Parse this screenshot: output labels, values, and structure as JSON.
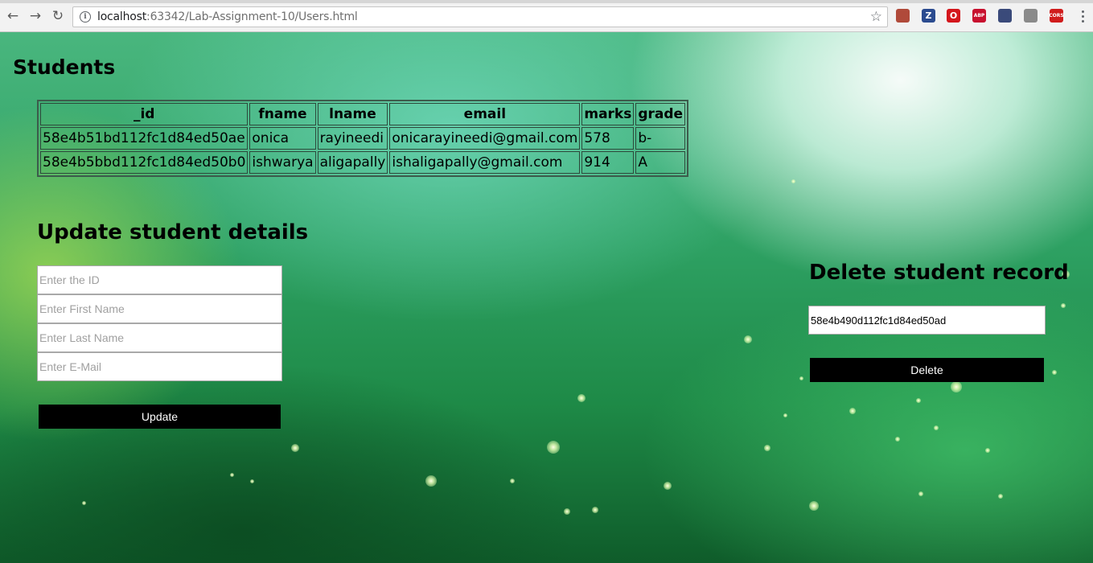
{
  "browser": {
    "url_host": "localhost",
    "url_rest": ":63342/Lab-Assignment-10/Users.html",
    "extensions": [
      {
        "name": "pdf-extension-icon",
        "color": "#b04a3a",
        "text": ""
      },
      {
        "name": "zotero-extension-icon",
        "color": "#2b4b8f",
        "text": "Z"
      },
      {
        "name": "opera-extension-icon",
        "color": "#d4161c",
        "text": "O"
      },
      {
        "name": "adblock-plus-icon",
        "color": "#c8102e",
        "text": "ABP"
      },
      {
        "name": "puzzle-extension-icon",
        "color": "#3a4a7a",
        "text": ""
      },
      {
        "name": "link-extension-icon",
        "color": "#8a8a8a",
        "text": ""
      },
      {
        "name": "cors-extension-icon",
        "color": "#d01c1c",
        "text": "CORS"
      }
    ]
  },
  "students": {
    "title": "Students",
    "columns": [
      "_id",
      "fname",
      "lname",
      "email",
      "marks",
      "grade"
    ],
    "rows": [
      [
        "58e4b51bd112fc1d84ed50ae",
        "onica",
        "rayineedi",
        "onicarayineedi@gmail.com",
        "578",
        "b-"
      ],
      [
        "58e4b5bbd112fc1d84ed50b0",
        "ishwarya",
        "aligapally",
        "ishaligapally@gmail.com",
        "914",
        "A"
      ]
    ]
  },
  "update": {
    "title": "Update student details",
    "id_placeholder": "Enter the ID",
    "fname_placeholder": "Enter First Name",
    "lname_placeholder": "Enter Last Name",
    "email_placeholder": "Enter E-Mail",
    "button_label": "Update"
  },
  "delete": {
    "title": "Delete student record",
    "id_value": "58e4b490d112fc1d84ed50ad",
    "button_label": "Delete"
  },
  "colors": {
    "button_bg": "#000000",
    "button_text": "#ffffff"
  }
}
